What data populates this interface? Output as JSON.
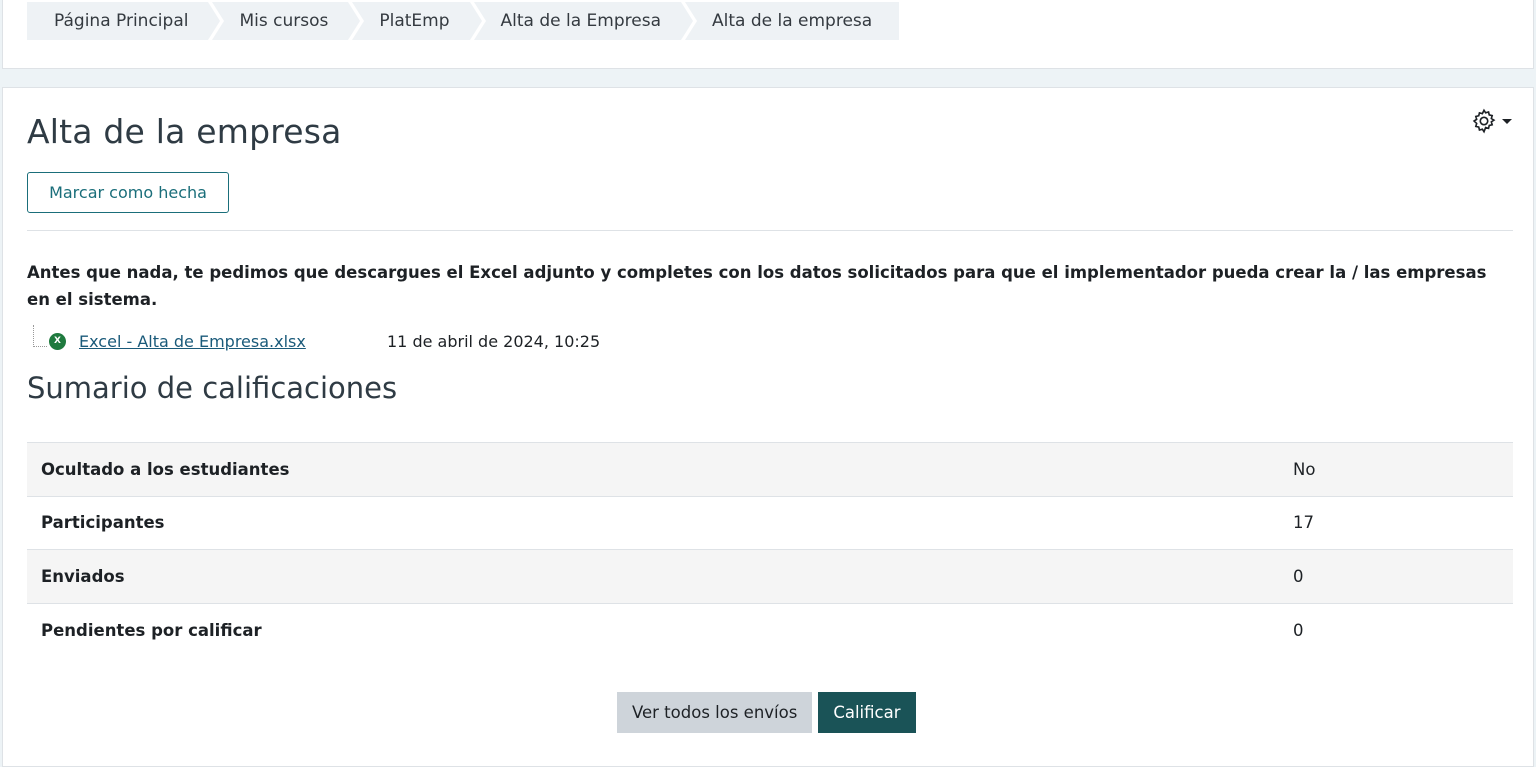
{
  "breadcrumb": [
    {
      "label": "Página Principal"
    },
    {
      "label": "Mis cursos"
    },
    {
      "label": "PlatEmp"
    },
    {
      "label": "Alta de la Empresa"
    },
    {
      "label": "Alta de la empresa"
    }
  ],
  "page": {
    "title": "Alta de la empresa",
    "settings_icon": "gear-icon",
    "mark_done_label": "Marcar como hecha",
    "intro": "Antes que nada, te pedimos que descargues el Excel adjunto y completes con los datos solicitados para que el implementador pueda crear la / las empresas en el sistema."
  },
  "attachment": {
    "icon": "excel-file-icon",
    "icon_letter": "X",
    "icon_color": "#1f7a3e",
    "filename": "Excel - Alta de Empresa.xlsx",
    "date": "11 de abril de 2024, 10:25"
  },
  "summary": {
    "title": "Sumario de calificaciones",
    "rows": [
      {
        "label": "Ocultado a los estudiantes",
        "value": "No"
      },
      {
        "label": "Participantes",
        "value": "17"
      },
      {
        "label": "Enviados",
        "value": "0"
      },
      {
        "label": "Pendientes por calificar",
        "value": "0"
      }
    ]
  },
  "actions": {
    "view_all": "Ver todos los envíos",
    "grade": "Calificar"
  },
  "colors": {
    "primary": "#1a5357",
    "accent": "#1a6e7a",
    "secondary": "#ced4da"
  }
}
